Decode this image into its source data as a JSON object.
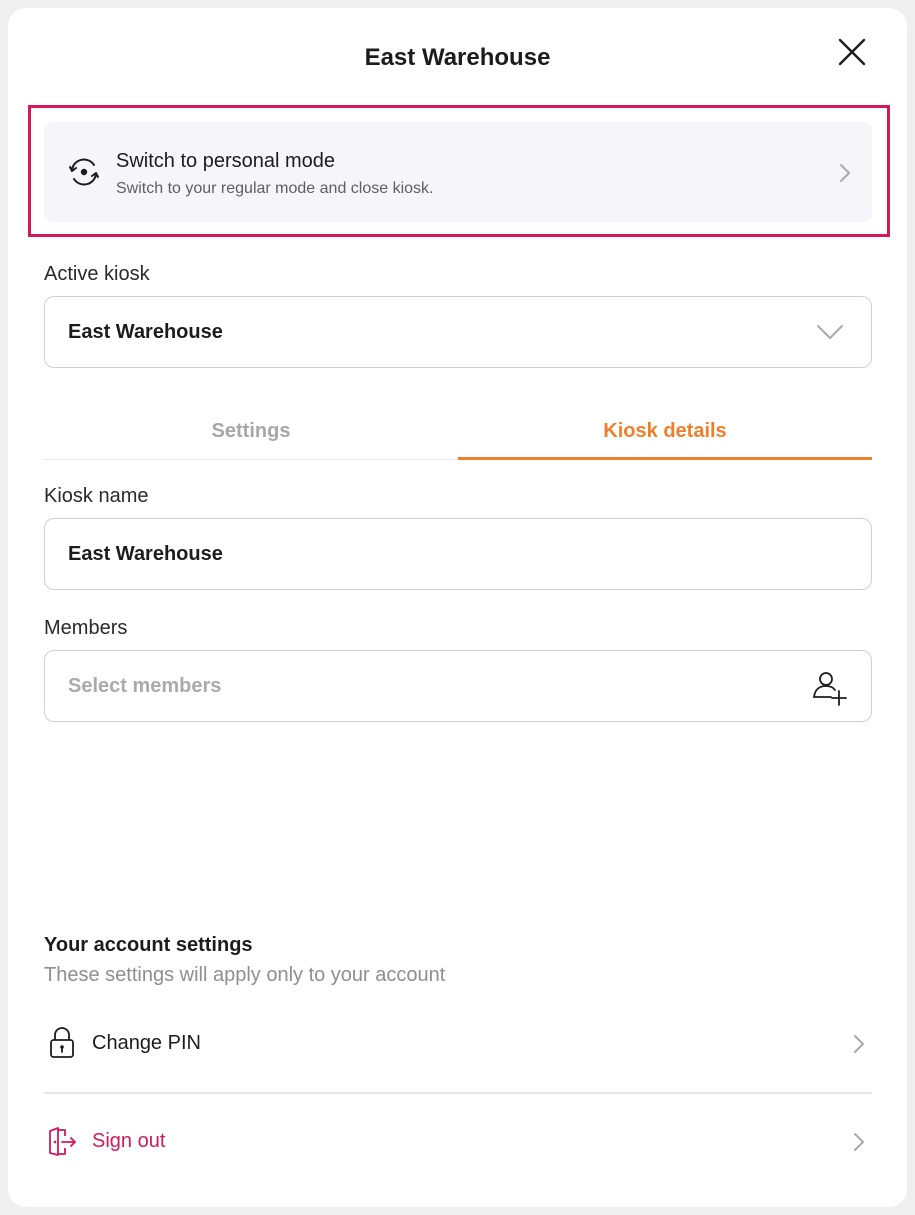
{
  "header": {
    "title": "East Warehouse"
  },
  "switch_mode": {
    "title": "Switch to personal mode",
    "subtitle": "Switch to your regular mode and close kiosk."
  },
  "active_kiosk": {
    "label": "Active kiosk",
    "value": "East Warehouse"
  },
  "tabs": [
    {
      "label": "Settings",
      "active": false
    },
    {
      "label": "Kiosk details",
      "active": true
    }
  ],
  "kiosk_name": {
    "label": "Kiosk name",
    "value": "East Warehouse"
  },
  "members": {
    "label": "Members",
    "placeholder": "Select members"
  },
  "account": {
    "title": "Your account settings",
    "subtitle": "These settings will apply only to your account",
    "items": [
      {
        "label": "Change PIN",
        "icon": "lock-icon"
      },
      {
        "label": "Sign out",
        "icon": "sign-out-icon"
      }
    ]
  },
  "colors": {
    "accent": "#f07f2b",
    "danger": "#d4185a",
    "highlight": "#d4185a"
  }
}
